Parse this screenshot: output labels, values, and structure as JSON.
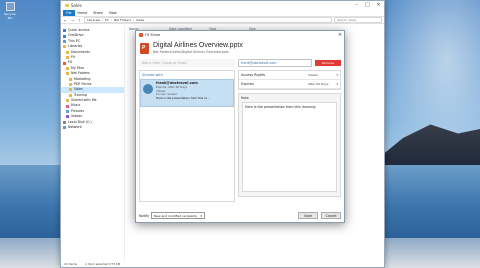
{
  "desktop": {
    "icon_label": "Recycle Bin"
  },
  "explorer": {
    "title": "Sales",
    "ribbon_tabs": [
      "File",
      "Home",
      "Share",
      "View"
    ],
    "address": [
      "Libraries",
      "Fit",
      "Net Folders",
      "Sales"
    ],
    "search_placeholder": "Search Sales",
    "column_headers": [
      "Name",
      "Date modified",
      "Type",
      "Size"
    ],
    "nav_items": [
      {
        "label": "Quick access"
      },
      {
        "label": "OneDrive"
      },
      {
        "label": "This PC"
      },
      {
        "label": "Libraries"
      },
      {
        "label": "Documents"
      },
      {
        "label": "Fit"
      },
      {
        "label": "Fit"
      },
      {
        "label": "My Files"
      },
      {
        "label": "Net Folders"
      },
      {
        "label": "Marketing"
      },
      {
        "label": "PDF Forms"
      },
      {
        "label": "Sales",
        "selected": true
      },
      {
        "label": "Training"
      },
      {
        "label": "Shared with Me"
      },
      {
        "label": "Music"
      },
      {
        "label": "Pictures"
      },
      {
        "label": "Videos"
      },
      {
        "label": "Local Disk (C:)"
      },
      {
        "label": "Network"
      }
    ],
    "status_items": "24 items",
    "status_selected": "1 item selected  573 KB"
  },
  "dialog": {
    "title": "Fit Share",
    "file_name": "Digital Airlines Overview.pptx",
    "file_path": "Net Folders\\Sales\\Digital Airlines Overview.pptx",
    "add_placeholder": "Add a User, Group or Email",
    "shared_with_label": "Shared with",
    "shared_user": {
      "email": "frank@abctravel.com",
      "line1": "Expires: After 60 Days",
      "line2": "Viewer",
      "line3": "Access: Viewer",
      "message": "Here is the presentation from this m..."
    },
    "recipient": "frank@abctravel.com",
    "remove_label": "Remove",
    "access_rights_label": "Access Rights",
    "access_rights_value": "Viewer",
    "expires_label": "Expires",
    "expires_value": "After 60 Days",
    "note_label": "Note",
    "note_text": "Here is the presentation from this morning",
    "notify_label": "Notify",
    "notify_value": "New and modified recipients",
    "save_label": "Save",
    "cancel_label": "Cancel"
  }
}
